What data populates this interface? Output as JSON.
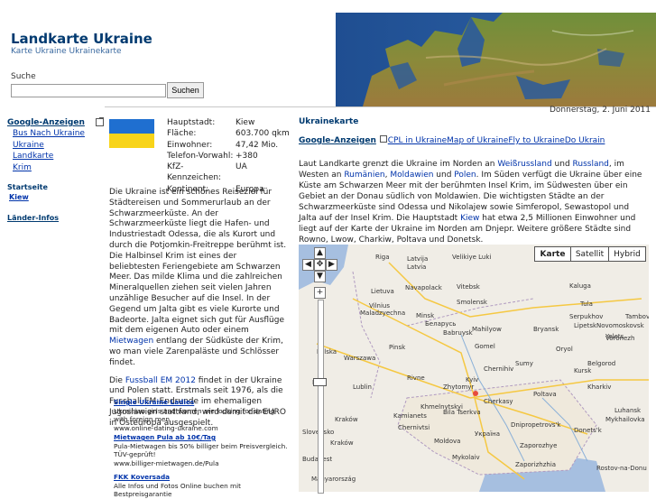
{
  "header": {
    "title": "Landkarte Ukraine",
    "subtitle": "Karte Ukraine Ukrainekarte",
    "search_label": "Suche",
    "search_value": "",
    "search_button": "Suchen",
    "date": "Donnerstag, 2. Juni 2011"
  },
  "sidebar": {
    "ads_heading": "Google-Anzeigen",
    "ads": [
      "Bus Nach Ukraine",
      "Ukraine",
      "Landkarte",
      "Krim"
    ],
    "start_heading": "Startseite",
    "start_link": "Kiew",
    "countries_heading": "Länder-Infos"
  },
  "facts": [
    {
      "k": "Hauptstadt:",
      "v": "Kiew"
    },
    {
      "k": "Fläche:",
      "v": "603.700 qkm"
    },
    {
      "k": "Einwohner:",
      "v": "47,42 Mio."
    },
    {
      "k": "Telefon-Vorwahl:",
      "v": "+380"
    },
    {
      "k": "KfZ-Kennzeichen:",
      "v": "UA"
    },
    {
      "k": "Kontinent:",
      "v": "Europa"
    }
  ],
  "left_text": {
    "p1_a": "Die Ukraine ist ein schönes Reiseziel für Städtereisen und Sommerurlaub an der Schwarzmeerküste. An der Schwarzmeerküste liegt die Hafen- und Industriestadt Odessa, die als Kurort und durch die Potjomkin-Freitreppe berühmt ist. Die Halbinsel Krim ist eines der beliebtesten Feriengebiete am Schwarzen Meer. Das milde Klima und die zahlreichen Mineralquellen ziehen seit vielen Jahren unzählige Besucher auf die Insel. In der Gegend um Jalta gibt es viele Kurorte und Badeorte. Jalta eignet sich gut für Ausflüge mit dem eigenen Auto oder einem ",
    "p1_link": "Mietwagen",
    "p1_b": " entlang der Südküste der Krim, wo man viele Zarenpaläste und Schlösser findet.",
    "p2_a": "Die ",
    "p2_link": "Fussball EM 2012",
    "p2_b": " findet in der Ukraine und Polen statt. Erstmals seit 1976, als die Fussball EM-Endrunde im ehemaligen Jugoslawien stattfand, wird damit die EURO in Osteuropa ausgespielt."
  },
  "ads_left": [
    {
      "title": "Single Ukraine Ladies",
      "body": "Ukrainian girls and women are looking for dating with foreign men",
      "url": "www.online-dating-ukraine.com"
    },
    {
      "title": "Mietwagen Pula ab 10€/Tag",
      "body": "Pula-Mietwagen bis 50% billiger beim Preisvergleich. TÜV-geprüft!",
      "url": "www.billiger-mietwagen.de/Pula"
    },
    {
      "title": "FKK Koversada",
      "body": "Alle Infos und Fotos Online buchen mit Bestpreisgarantie",
      "url": ""
    }
  ],
  "right": {
    "heading": "Ukrainekarte",
    "ads_heading": "Google-Anzeigen",
    "ads_links": [
      "CPL in Ukraine",
      "Map of Ukraine",
      "Fly to Ukraine",
      "Do Ukrain"
    ],
    "t1": "Laut Landkarte grenzt die Ukraine im Norden an ",
    "l1": "Weißrussland",
    "t2": " und ",
    "l2": "Russland",
    "t3": ", im Westen an ",
    "l3": "Rumänien",
    "t4": ", ",
    "l4": "Moldawien",
    "t5": " und ",
    "l5": "Polen",
    "t6": ". Im Süden verfügt die Ukraine über eine Küste am Schwarzen Meer mit der berühmten Insel Krim, im Südwesten über ein Gebiet an der Donau südlich von Moldawien. Die wichtigsten Städte an der Schwarzmeerküste sind Odessa und Nikolajew sowie Simferopol, Sewastopol und Jalta auf der Insel Krim. Die Hauptstadt ",
    "l6": "Kiew",
    "t7": " hat etwa 2,5 Millionen Einwohner und liegt auf der Karte der Ukraine im Norden am Dnjepr. Weitere größere Städte sind Rowno, Lwow, Charkiw, Poltava und Donetsk."
  },
  "map": {
    "type_buttons": [
      "Karte",
      "Satellit",
      "Hybrid"
    ],
    "selected": "Karte",
    "labels": [
      {
        "t": "Riga"
      },
      {
        "t": "Latvija"
      },
      {
        "t": "Latvia"
      },
      {
        "t": "Velikiye Luki"
      },
      {
        "t": "Rzhev"
      },
      {
        "t": "Lietuva"
      },
      {
        "t": "Navapolack"
      },
      {
        "t": "Vitebsk"
      },
      {
        "t": "Smolensk"
      },
      {
        "t": "Vilnius"
      },
      {
        "t": "Maladzyechna"
      },
      {
        "t": "Minsk"
      },
      {
        "t": "Беларусь"
      },
      {
        "t": "Babruysk"
      },
      {
        "t": "Mahilyow"
      },
      {
        "t": "Bryansk"
      },
      {
        "t": "Kaluga"
      },
      {
        "t": "Tula"
      },
      {
        "t": "Oryol"
      },
      {
        "t": "Kursk"
      },
      {
        "t": "Gomel"
      },
      {
        "t": "Chernihiv"
      },
      {
        "t": "Pinsk"
      },
      {
        "t": "Warszawa"
      },
      {
        "t": "Polska"
      },
      {
        "t": "Lodz"
      },
      {
        "t": "Lublin"
      },
      {
        "t": "Kraków"
      },
      {
        "t": "Rivne"
      },
      {
        "t": "Zhytomyr"
      },
      {
        "t": "Kyiv"
      },
      {
        "t": "Sumy"
      },
      {
        "t": "Belgorod"
      },
      {
        "t": "Kharkiv"
      },
      {
        "t": "Poltava"
      },
      {
        "t": "Cherkasy"
      },
      {
        "t": "Україна"
      },
      {
        "t": "Dnipropetrovs'k"
      },
      {
        "t": "Donets'k"
      },
      {
        "t": "Zaporozhye"
      },
      {
        "t": "Voronezh"
      },
      {
        "t": "Lipetsk"
      },
      {
        "t": "Tambov"
      },
      {
        "t": "Serpukhov"
      },
      {
        "t": "Novomoskovsk"
      },
      {
        "t": "Yelets"
      },
      {
        "t": "Mykolaiv"
      },
      {
        "t": "Slovensko"
      },
      {
        "t": "Budapest"
      },
      {
        "t": "Moldova"
      },
      {
        "t": "Luhansk"
      },
      {
        "t": "Magyarország"
      },
      {
        "t": "Rostov-na-Donu"
      },
      {
        "t": "Khmelnytskyi"
      },
      {
        "t": "Chernivtsi"
      },
      {
        "t": "Kamianets"
      },
      {
        "t": "Bila Tserkva"
      },
      {
        "t": "Mykhailovka"
      },
      {
        "t": "Kraków"
      },
      {
        "t": "Zaporizhzhia"
      }
    ]
  },
  "colors": {
    "title": "#003a70",
    "link": "#0033aa",
    "flag_blue": "#1f6fd0",
    "flag_yellow": "#f8d41a"
  }
}
